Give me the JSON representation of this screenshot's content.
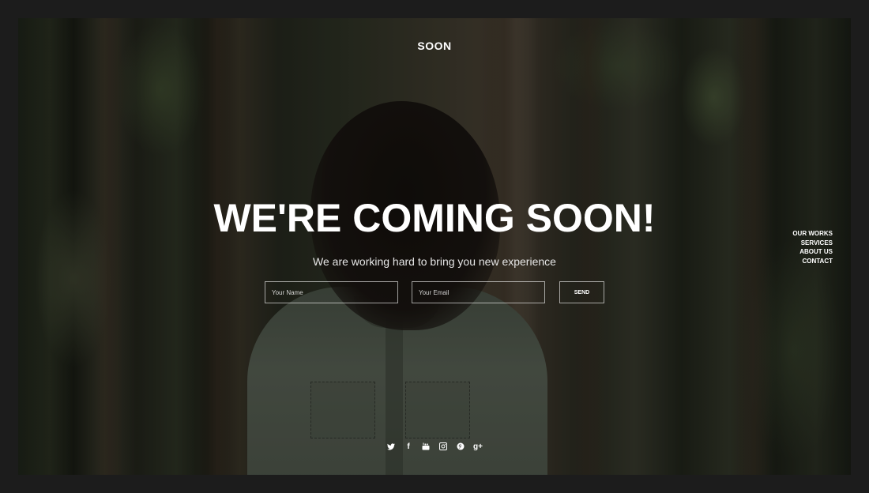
{
  "brand": {
    "logo_text": "SOON"
  },
  "hero": {
    "headline": "WE'RE COMING SOON!",
    "subheadline": "We are working hard to bring you new experience"
  },
  "form": {
    "name_placeholder": "Your Name",
    "email_placeholder": "Your Email",
    "send_label": "SEND"
  },
  "nav": {
    "items": [
      {
        "label": "OUR WORKS"
      },
      {
        "label": "SERVICES"
      },
      {
        "label": "ABOUT US"
      },
      {
        "label": "CONTACT"
      }
    ]
  },
  "social": {
    "icons": [
      "twitter-icon",
      "facebook-icon",
      "youtube-icon",
      "instagram-icon",
      "pinterest-icon",
      "google-plus-icon"
    ],
    "facebook_glyph": "f",
    "google_plus_glyph": "g+"
  },
  "colors": {
    "text": "#ffffff",
    "frame_bg": "#1c1c1c",
    "field_border": "#ffffff"
  }
}
